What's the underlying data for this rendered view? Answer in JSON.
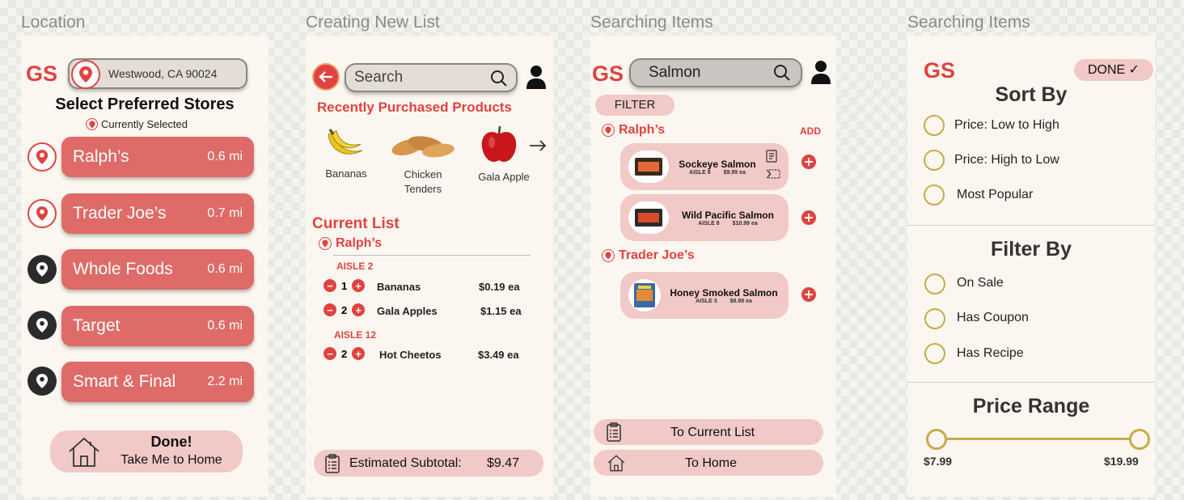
{
  "frames": [
    {
      "title": "Location"
    },
    {
      "title": "Creating New List"
    },
    {
      "title": "Searching Items"
    },
    {
      "title": "Searching Items"
    }
  ],
  "location": {
    "logo": "GS",
    "address": "Westwood, CA 90024",
    "heading": "Select Preferred Stores",
    "selected_legend": "Currently Selected",
    "stores": [
      {
        "name": "Ralph’s",
        "distance": "0.6 mi",
        "selected": true
      },
      {
        "name": "Trader Joe’s",
        "distance": "0.7 mi",
        "selected": true
      },
      {
        "name": "Whole Foods",
        "distance": "0.6 mi",
        "selected": false
      },
      {
        "name": "Target",
        "distance": "0.6 mi",
        "selected": false
      },
      {
        "name": "Smart & Final",
        "distance": "2.2 mi",
        "selected": false
      }
    ],
    "done_title": "Done!",
    "done_subtitle": "Take Me to Home"
  },
  "newlist": {
    "search_placeholder": "Search",
    "recent_heading": "Recently Purchased Products",
    "recent": [
      {
        "label": "Bananas"
      },
      {
        "label": "Chicken Tenders"
      },
      {
        "label": "Gala Apple"
      }
    ],
    "current_heading": "Current List",
    "store": "Ralph’s",
    "aisles": [
      {
        "label": "AISLE 2",
        "items": [
          {
            "qty": "1",
            "name": "Bananas",
            "price": "$0.19 ea"
          },
          {
            "qty": "2",
            "name": "Gala Apples",
            "price": "$1.15 ea"
          }
        ]
      },
      {
        "label": "AISLE 12",
        "items": [
          {
            "qty": "2",
            "name": "Hot Cheetos",
            "price": "$3.49 ea"
          }
        ]
      }
    ],
    "subtotal_label": "Estimated Subtotal:",
    "subtotal_value": "$9.47"
  },
  "search": {
    "logo": "GS",
    "query": "Salmon",
    "filter_label": "FILTER",
    "add_label": "ADD",
    "stores": [
      {
        "name": "Ralph’s",
        "items": [
          {
            "name": "Sockeye Salmon",
            "aisle": "AISLE 8",
            "price": "$9.99 ea"
          },
          {
            "name": "Wild Pacific Salmon",
            "aisle": "AISLE 8",
            "price": "$10.99 ea"
          }
        ]
      },
      {
        "name": "Trader Joe’s",
        "items": [
          {
            "name": "Honey Smoked Salmon",
            "aisle": "AISLE 3",
            "price": "$8.99 ea"
          }
        ]
      }
    ],
    "to_list": "To Current List",
    "to_home": "To Home"
  },
  "filter": {
    "logo": "GS",
    "done_label": "DONE ✓",
    "sort_heading": "Sort By",
    "sort_options": [
      "Price: Low to High",
      "Price: High to Low",
      "Most Popular"
    ],
    "filter_heading": "Filter By",
    "filter_options": [
      "On Sale",
      "Has Coupon",
      "Has Recipe"
    ],
    "price_heading": "Price Range",
    "price_min": "$7.99",
    "price_max": "$19.99"
  },
  "colors": {
    "brand_red": "#e0433f",
    "button_red": "#de6b67",
    "pink": "#f1c9c6",
    "gold": "#c9a94a"
  }
}
